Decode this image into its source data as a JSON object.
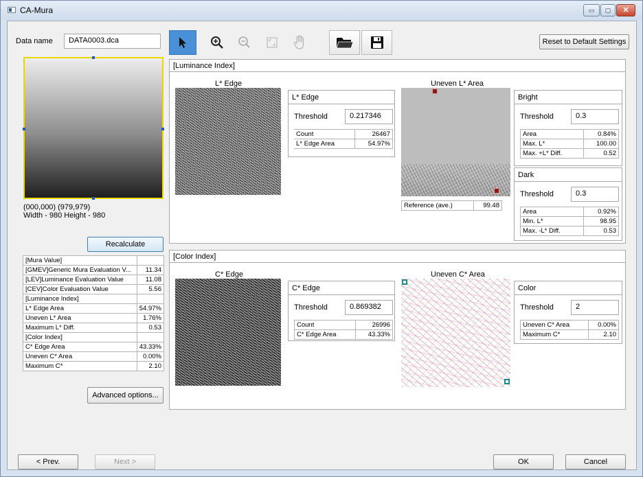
{
  "window": {
    "title": "CA-Mura",
    "controls": {
      "minimize": "▭",
      "maximize": "▢",
      "close": "✕"
    }
  },
  "data_name": {
    "label": "Data name",
    "value": "DATA0003.dca"
  },
  "toolbar": {
    "reset_label": "Reset to Default Settings",
    "tools": [
      "pointer-icon",
      "zoom-in-icon",
      "zoom-out-icon",
      "fit-icon",
      "hand-icon",
      "open-folder-icon",
      "save-icon"
    ]
  },
  "preview": {
    "coords": "(000,000) (979,979)",
    "size": "Width - 980 Height - 980"
  },
  "recalculate_label": "Recalculate",
  "mura_table": [
    [
      "[Mura Value]",
      ""
    ],
    [
      "[GMEV]Generic Mura Evaluation V...",
      "11.34"
    ],
    [
      "[LEV]Luminance Evaluation Value",
      "11.08"
    ],
    [
      "[CEV]Color Evaluation Value",
      "5.56"
    ],
    [
      "[Luminance Index]",
      ""
    ],
    [
      "L* Edge Area",
      "54.97%"
    ],
    [
      "Uneven L* Area",
      "1.76%"
    ],
    [
      "Maximum L* Diff.",
      "0.53"
    ],
    [
      "[Color Index]",
      ""
    ],
    [
      "C* Edge Area",
      "43.33%"
    ],
    [
      "Uneven C* Area",
      "0.00%"
    ],
    [
      "Maximum C*",
      "2.10"
    ]
  ],
  "advanced_label": "Advanced options...",
  "luminance": {
    "header": "[Luminance Index]",
    "edge_title": "L* Edge",
    "edge_box": {
      "title": "L* Edge",
      "threshold_label": "Threshold",
      "threshold": "0.217346",
      "rows": [
        [
          "Count",
          "26467"
        ],
        [
          "L* Edge Area",
          "54.97%"
        ]
      ]
    },
    "uneven_title": "Uneven L* Area",
    "reference": {
      "label": "Reference (ave.)",
      "value": "99.48"
    },
    "bright": {
      "title": "Bright",
      "threshold_label": "Threshold",
      "threshold": "0.3",
      "rows": [
        [
          "Area",
          "0.84%"
        ],
        [
          "Max. L*",
          "100.00"
        ],
        [
          "Max. +L* Diff.",
          "0.52"
        ]
      ]
    },
    "dark": {
      "title": "Dark",
      "threshold_label": "Threshold",
      "threshold": "0.3",
      "rows": [
        [
          "Area",
          "0.92%"
        ],
        [
          "Min. L*",
          "98.95"
        ],
        [
          "Max. -L* Diff.",
          "0.53"
        ]
      ]
    }
  },
  "color": {
    "header": "[Color Index]",
    "edge_title": "C* Edge",
    "edge_box": {
      "title": "C* Edge",
      "threshold_label": "Threshold",
      "threshold": "0.869382",
      "rows": [
        [
          "Count",
          "26996"
        ],
        [
          "C* Edge Area",
          "43.33%"
        ]
      ]
    },
    "uneven_title": "Uneven C* Area",
    "color_box": {
      "title": "Color",
      "threshold_label": "Threshold",
      "threshold": "2",
      "rows": [
        [
          "Uneven C* Area",
          "0.00%"
        ],
        [
          "Maximum C*",
          "2.10"
        ]
      ]
    }
  },
  "nav": {
    "prev": "< Prev.",
    "next": "Next >",
    "ok": "OK",
    "cancel": "Cancel"
  },
  "colors": {
    "accent": "#4a90d6",
    "selection": "#e8d800",
    "bright_marker": "#8b1a1a",
    "color_marker": "#1a8a8a"
  }
}
